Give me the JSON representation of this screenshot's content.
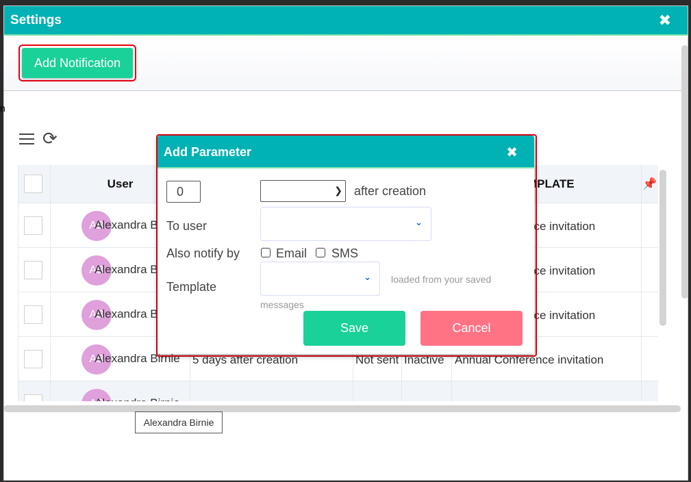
{
  "window": {
    "title": "Settings",
    "close_icon": "close-x-icon"
  },
  "toolbar": {
    "add_notification_label": "Add Notification",
    "menu_icon": "hamburger-icon",
    "refresh_icon": "refresh-icon"
  },
  "left_fragment": "n",
  "grid": {
    "columns": [
      "",
      "User",
      "",
      "",
      "",
      "TEMPLATE",
      ""
    ],
    "visible_header_user": "User",
    "visible_header_template": "MPLATE",
    "pin_icon": "pin-icon",
    "rows": [
      {
        "initials": "AB",
        "user": "Alexandra B",
        "when": "",
        "sent": "",
        "status": "",
        "template": "nce invitation"
      },
      {
        "initials": "AB",
        "user": "Alexandra B",
        "when": "",
        "sent": "",
        "status": "",
        "template": "nce invitation"
      },
      {
        "initials": "AB",
        "user": "Alexandra B",
        "when": "",
        "sent": "",
        "status": "",
        "template": "nce invitation"
      },
      {
        "initials": "AB",
        "user": "Alexandra Birnie",
        "when": "5 days after creation",
        "sent": "Not sent",
        "status": "Inactive",
        "template": "Annual Conference invitation"
      },
      {
        "initials": "AB",
        "user": "Alexandra Birnie",
        "when": "",
        "sent": "",
        "status": "",
        "template": ""
      }
    ]
  },
  "tooltip": "Alexandra Birnie",
  "modal": {
    "title": "Add Parameter",
    "offset_value": "0",
    "unit_select_value": "",
    "after_label": "after creation",
    "to_user_label": "To user",
    "to_user_value": "",
    "also_notify_label": "Also notify by",
    "email_label": "Email",
    "email_checked": false,
    "sms_label": "SMS",
    "sms_checked": false,
    "template_label": "Template",
    "template_value": "",
    "template_hint_line1": "loaded from your saved",
    "template_hint_line2": "messages",
    "save_label": "Save",
    "cancel_label": "Cancel"
  },
  "colors": {
    "header_teal": "#00b2b4",
    "primary_green": "#19d199",
    "cancel_pink": "#ff7384",
    "avatar": "#dfa0dc",
    "highlight_red": "#e60012"
  }
}
